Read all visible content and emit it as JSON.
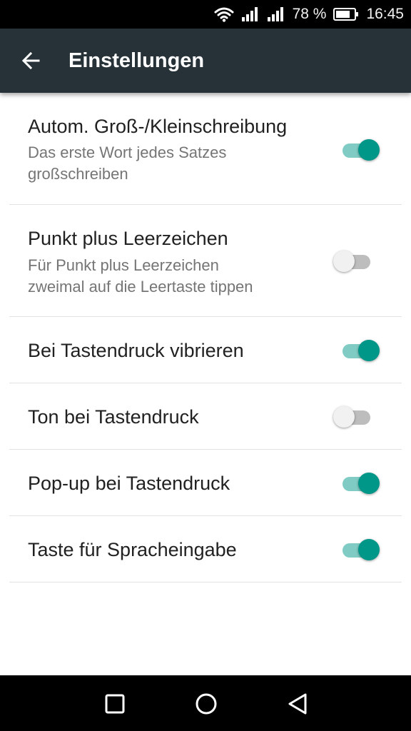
{
  "status_bar": {
    "battery_percent": "78 %",
    "time": "16:45",
    "icons": [
      "wifi-icon",
      "signal-icon",
      "signal-icon",
      "battery-icon"
    ]
  },
  "app_bar": {
    "title": "Einstellungen",
    "back_icon": "arrow-left-icon"
  },
  "settings": [
    {
      "title": "Autom. Groß-/Kleinschreibung",
      "summary_line1": "Das erste Wort jedes Satzes",
      "summary_line2": "großschreiben",
      "enabled": true
    },
    {
      "title": "Punkt plus Leerzeichen",
      "summary_line1": "Für Punkt plus Leerzeichen",
      "summary_line2": "zweimal auf die Leertaste tippen",
      "enabled": false
    },
    {
      "title": "Bei Tastendruck vibrieren",
      "enabled": true
    },
    {
      "title": "Ton bei Tastendruck",
      "enabled": false
    },
    {
      "title": "Pop-up bei Tastendruck",
      "enabled": true
    },
    {
      "title": "Taste für Spracheingabe",
      "enabled": true
    }
  ],
  "colors": {
    "app_bar": "#263238",
    "toggle_on_thumb": "#009688",
    "toggle_on_track": "#80cbc4",
    "toggle_off_thumb": "#f1f1f1",
    "toggle_off_track": "#bdbdbd"
  },
  "nav_bar": {
    "icons": [
      "recents-square-icon",
      "home-circle-icon",
      "back-triangle-icon"
    ]
  }
}
